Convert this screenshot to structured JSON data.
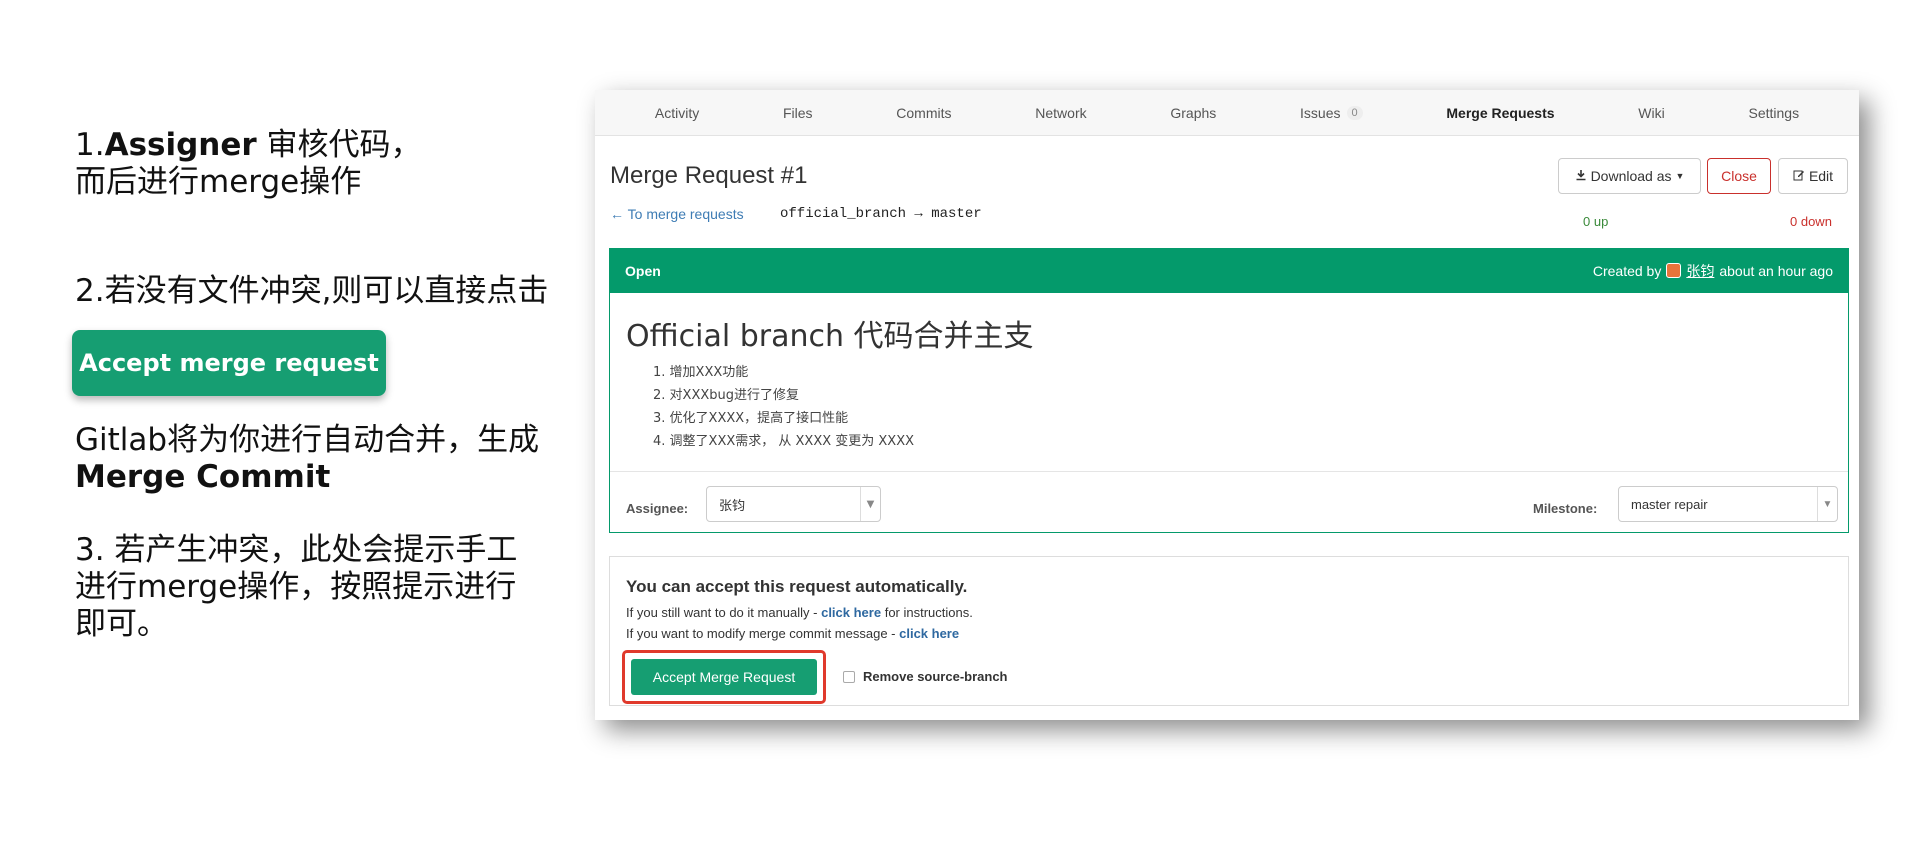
{
  "instructions": {
    "step1_prefix": "1.",
    "step1_bold": "Assigner",
    "step1_rest": " 审核代码，",
    "step1_line2": "而后进行merge操作",
    "step2": "2.若没有文件冲突,则可以直接点击",
    "accept_button": "Accept merge request",
    "result_line1": "Gitlab将为你进行自动合并，生成",
    "result_bold": "Merge Commit",
    "step3_line1": "3. 若产生冲突，此处会提示手工",
    "step3_line2": "进行merge操作，按照提示进行",
    "step3_line3": "即可。"
  },
  "nav": {
    "items": [
      {
        "label": "Activity"
      },
      {
        "label": "Files"
      },
      {
        "label": "Commits"
      },
      {
        "label": "Network"
      },
      {
        "label": "Graphs"
      },
      {
        "label": "Issues",
        "badge": "0"
      },
      {
        "label": "Merge Requests",
        "active": true
      },
      {
        "label": "Wiki"
      },
      {
        "label": "Settings"
      }
    ]
  },
  "merge_request": {
    "title": "Merge Request #1",
    "download_label": "Download as",
    "close_label": "Close",
    "edit_label": "Edit",
    "back_link": "← To merge requests",
    "branch": "official_branch → master",
    "votes_up": "0 up",
    "votes_down": "0 down",
    "status": "Open",
    "created_prefix": "Created by",
    "author": "张钧",
    "created_suffix": "about an hour ago",
    "heading": "Official branch 代码合并主支",
    "items": [
      "1. 增加XXX功能",
      "2. 对XXXbug进行了修复",
      "3. 优化了XXXX，提高了接口性能",
      "4. 调整了XXX需求， 从 XXXX 变更为 XXXX"
    ],
    "assignee_label": "Assignee:",
    "assignee_value": "张钧",
    "milestone_label": "Milestone:",
    "milestone_value": "master repair"
  },
  "accept": {
    "title": "You can accept this request automatically.",
    "line1_prefix": "If you still want to do it manually - ",
    "line1_link": "click here",
    "line1_suffix": " for instructions.",
    "line2_prefix": "If you want to modify merge commit message - ",
    "line2_link": "click here",
    "button": "Accept Merge Request",
    "remove_source": "Remove source-branch"
  },
  "colors": {
    "accent_green": "#049a6b",
    "button_green": "#169e72",
    "highlight_red": "#e0392c",
    "link_blue": "#3e7cb4"
  }
}
